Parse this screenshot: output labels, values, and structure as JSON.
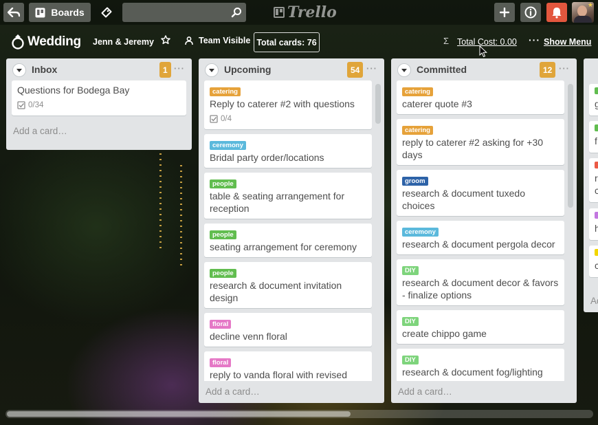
{
  "topbar": {
    "boards_label": "Boards",
    "search_value": "",
    "logo_text": "Trello"
  },
  "board": {
    "title": "Wedding",
    "team_name": "Jenn & Jeremy",
    "visibility": "Team Visible",
    "total_cards": "Total cards: 76",
    "total_cost": "Total Cost: 0.00",
    "show_menu": "Show Menu"
  },
  "label_colors": {
    "catering": "#e6a23a",
    "ceremony": "#5bb9dc",
    "people": "#61bd4f",
    "floral": "#e578c6",
    "groom": "#2e63a8",
    "diy": "#7ed47c"
  },
  "lists": [
    {
      "name": "Inbox",
      "count": "1",
      "add_card": "Add a card…",
      "cards": [
        {
          "title": "Questions for Bodega Bay",
          "checklist": "0/34"
        }
      ]
    },
    {
      "name": "Upcoming",
      "count": "54",
      "add_card": "Add a card…",
      "cards": [
        {
          "label": "catering",
          "title": "Reply to caterer #2 with questions",
          "checklist": "0/4"
        },
        {
          "label": "ceremony",
          "title": "Bridal party order/locations"
        },
        {
          "label": "people",
          "title": "table & seating arrangement for reception"
        },
        {
          "label": "people",
          "title": "seating arrangement for ceremony"
        },
        {
          "label": "people",
          "title": "research & document invitation design"
        },
        {
          "label": "floral",
          "title": "decline venn floral"
        },
        {
          "label": "floral",
          "title": "reply to vanda floral with revised"
        }
      ]
    },
    {
      "name": "Committed",
      "count": "12",
      "add_card": "Add a card…",
      "cards": [
        {
          "label": "catering",
          "title": "caterer quote #3"
        },
        {
          "label": "catering",
          "title": "reply to caterer #2 asking for +30 days"
        },
        {
          "label": "groom",
          "title": "research & document tuxedo choices"
        },
        {
          "label": "ceremony",
          "title": "research & document pergola decor"
        },
        {
          "label": "DIY",
          "title": "research & document decor & favors - finalize options"
        },
        {
          "label": "DIY",
          "title": "create chippo game"
        },
        {
          "label": "DIY",
          "title": "research & document fog/lighting"
        }
      ]
    }
  ],
  "peek_list": {
    "letters": [
      "g",
      "f",
      "r",
      "c",
      "h",
      "c"
    ],
    "add_card": "Ad",
    "label_colors": [
      "#61bd4f",
      "#61bd4f",
      "#eb5a46",
      "#c377e0",
      "#f2d600"
    ]
  }
}
